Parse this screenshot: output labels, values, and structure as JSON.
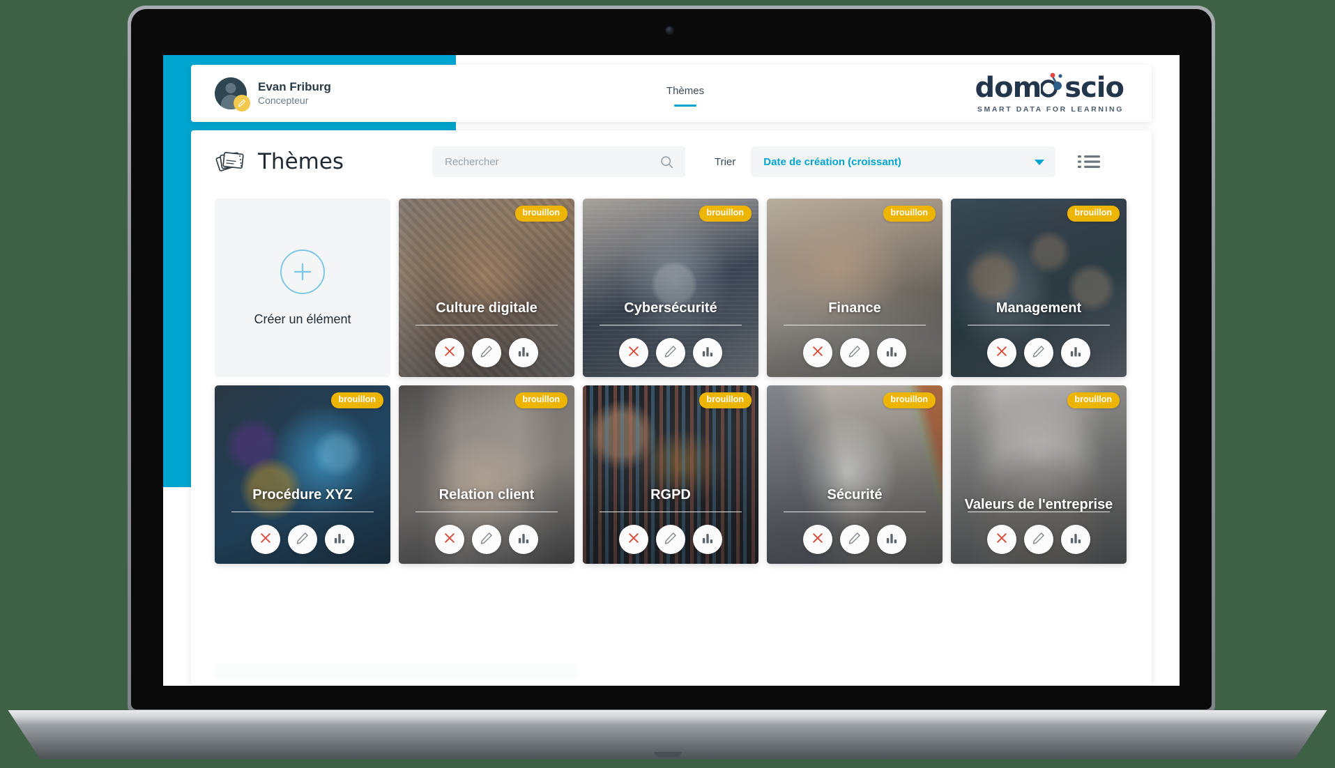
{
  "header": {
    "profile": {
      "name": "Evan Friburg",
      "role": "Concepteur",
      "avatar_icon": "user-avatar-icon",
      "edit_badge_icon": "pencil-badge-icon"
    },
    "nav": [
      {
        "label": "Thèmes",
        "active": true
      }
    ],
    "brand": {
      "word": "domoscio",
      "tagline": "SMART DATA FOR LEARNING"
    }
  },
  "toolbar": {
    "title": "Thèmes",
    "title_icon": "cards-stack-icon",
    "search": {
      "placeholder": "Rechercher",
      "value": "",
      "icon": "search-icon"
    },
    "sort": {
      "label": "Trier",
      "selected": "Date de création (croissant)",
      "caret_icon": "chevron-down-icon"
    },
    "view_toggle_icon": "list-view-icon"
  },
  "create_card": {
    "label": "Créer un élément",
    "icon": "plus-circle-icon"
  },
  "actions": {
    "delete_icon": "close-x-icon",
    "edit_icon": "pencil-icon",
    "stats_icon": "bar-chart-icon"
  },
  "status_badge_label": "brouillon",
  "cards": [
    {
      "title": "Culture digitale",
      "badge": "brouillon",
      "photo": "ph-culture",
      "two_line": false
    },
    {
      "title": "Cybersécurité",
      "badge": "brouillon",
      "photo": "ph-cyber",
      "two_line": false
    },
    {
      "title": "Finance",
      "badge": "brouillon",
      "photo": "ph-finance",
      "two_line": false
    },
    {
      "title": "Management",
      "badge": "brouillon",
      "photo": "ph-management",
      "two_line": false
    },
    {
      "title": "Procédure XYZ",
      "badge": "brouillon",
      "photo": "ph-procedure",
      "two_line": false
    },
    {
      "title": "Relation client",
      "badge": "brouillon",
      "photo": "ph-relation",
      "two_line": false
    },
    {
      "title": "RGPD",
      "badge": "brouillon",
      "photo": "ph-rgpd",
      "two_line": false
    },
    {
      "title": "Sécurité",
      "badge": "brouillon",
      "photo": "ph-securite",
      "two_line": false
    },
    {
      "title": "Valeurs de l'entreprise",
      "badge": "brouillon",
      "photo": "ph-valeurs",
      "two_line": true
    }
  ],
  "colors": {
    "accent_cyan": "#00a5cf",
    "badge_yellow": "#edb400",
    "delete_red": "#d94a3a",
    "create_circle": "#7ec8e3",
    "page_bg": "#3e6045"
  }
}
